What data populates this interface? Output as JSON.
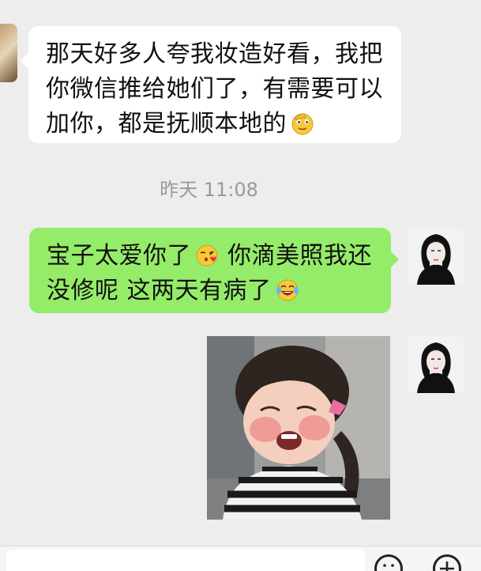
{
  "messages": [
    {
      "direction": "incoming",
      "text": "那天好多人夸我妆造好看，我把\n你微信推给她们了，有需要可以\n加你，都是抚顺本地的",
      "emoji": "salute-face-emoji"
    },
    {
      "direction": "outgoing",
      "text_part1": "宝子太爱你了",
      "emoji1": "kissing-heart-emoji",
      "text_part2": " 你滴美照我还\n没修呢 这两天有病了",
      "emoji2": "crying-laughing-emoji"
    },
    {
      "direction": "outgoing",
      "type": "sticker",
      "sticker": "laughing-toddler-sticker"
    }
  ],
  "timestamp": "昨天 11:08",
  "colors": {
    "background": "#ededed",
    "incoming_bubble": "#ffffff",
    "outgoing_bubble": "#95ec69",
    "timestamp": "#9a9a9a"
  },
  "input_bar": {
    "icons": [
      "emoji-face-icon",
      "plus-icon"
    ]
  }
}
